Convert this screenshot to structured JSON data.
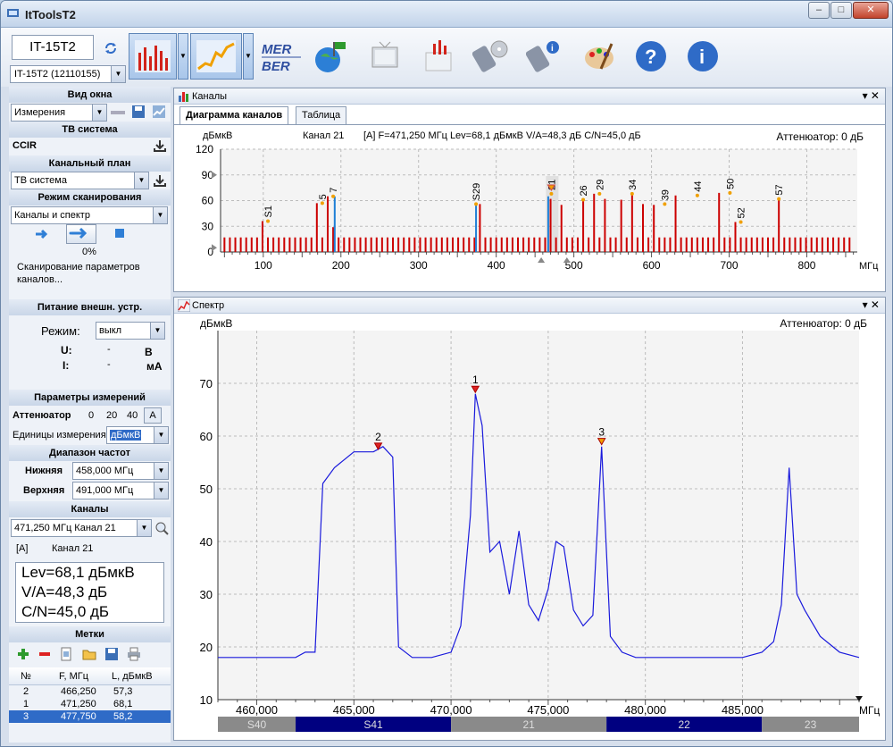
{
  "app": {
    "title": "ItToolsT2"
  },
  "device": {
    "name": "IT-15T2",
    "selector": "IT-15T2 (12110155)"
  },
  "sidebar": {
    "view_header": "Вид окна",
    "view_value": "Измерения",
    "tv_header": "ТВ система",
    "tv_value": "CCIR",
    "plan_header": "Канальный план",
    "plan_value": "ТВ система",
    "scan_header": "Режим сканирования",
    "scan_value": "Каналы и спектр",
    "scan_progress": "0%",
    "scan_progress_fraction": 0,
    "scan_status": "Сканирование параметров каналов...",
    "power_header": "Питание внешн. устр.",
    "power_mode_label": "Режим:",
    "power_mode_value": "выкл",
    "u_label": "U:",
    "u_value": "-",
    "u_unit": "В",
    "i_label": "I:",
    "i_value": "-",
    "i_unit": "мА",
    "meas_header": "Параметры измерений",
    "attenuator_label": "Аттенюатор",
    "att_opts": [
      "0",
      "20",
      "40",
      "A"
    ],
    "units_label": "Единицы измерения",
    "units_value": "дБмкВ",
    "range_header": "Диапазон частот",
    "low_label": "Нижняя",
    "low_value": "458,000 МГц",
    "high_label": "Верхняя",
    "high_value": "491,000 МГц",
    "channels_header": "Каналы",
    "channel_value": "471,250 МГц  Канал 21",
    "ch_mark": "[A]",
    "ch_name": "Канал 21",
    "lev": "Lev=68,1 дБмкВ",
    "va": "V/A=48,3 дБ",
    "cn": "C/N=45,0 дБ",
    "markers_header": "Метки",
    "markers_cols": [
      "№",
      "F, МГц",
      "L, дБмкВ"
    ],
    "markers": [
      {
        "n": "2",
        "f": "466,250",
        "l": "57,3"
      },
      {
        "n": "1",
        "f": "471,250",
        "l": "68,1"
      },
      {
        "n": "3",
        "f": "477,750",
        "l": "58,2"
      }
    ]
  },
  "channels_panel": {
    "title": "Каналы",
    "tabs": [
      "Диаграмма каналов",
      "Таблица"
    ],
    "info": "[A]   F=471,250 МГц  Lev=68,1 дБмкВ  V/A=48,3 дБ   C/N=45,0 дБ",
    "channel_title": "Канал 21",
    "attenuator": "Аттенюатор: 0 дБ"
  },
  "spectrum_panel": {
    "title": "Спектр",
    "attenuator": "Аттенюатор: 0 дБ"
  },
  "colors": {
    "accent": "#2f6bc7",
    "bar_red": "#cc0000",
    "bar_blue": "#1f7fd6",
    "trace": "#1a1adc"
  },
  "chart_data": [
    {
      "type": "bar",
      "ylabel": "дБмкВ",
      "xlabel": "МГц",
      "ylim": [
        0,
        120
      ],
      "xlim": [
        45,
        865
      ],
      "x_ticks": [
        100,
        200,
        300,
        400,
        500,
        600,
        700,
        800
      ],
      "y_ticks": [
        0,
        30,
        60,
        90,
        120
      ],
      "grid": true,
      "bars_x": [
        50,
        57,
        64,
        71,
        78,
        85,
        92,
        99,
        106,
        113,
        120,
        127,
        134,
        141,
        148,
        155,
        162,
        169,
        176,
        183,
        190,
        197,
        204,
        211,
        218,
        225,
        232,
        239,
        246,
        253,
        260,
        267,
        274,
        281,
        288,
        295,
        302,
        309,
        316,
        323,
        330,
        337,
        344,
        351,
        358,
        365,
        372,
        379,
        386,
        393,
        400,
        407,
        414,
        421,
        428,
        435,
        442,
        449,
        456,
        463,
        470,
        477,
        484,
        491,
        498,
        505,
        512,
        519,
        526,
        533,
        540,
        547,
        554,
        561,
        568,
        575,
        582,
        589,
        596,
        603,
        610,
        617,
        624,
        631,
        638,
        645,
        652,
        659,
        666,
        673,
        680,
        687,
        694,
        701,
        708,
        715,
        722,
        729,
        736,
        743,
        750,
        757,
        764,
        771,
        778,
        785,
        792,
        799,
        806,
        813,
        820,
        827,
        834,
        841,
        848,
        855
      ],
      "bars_y": [
        17,
        17,
        17,
        17,
        17,
        17,
        17,
        36,
        17,
        17,
        17,
        17,
        17,
        17,
        17,
        17,
        17,
        57,
        17,
        65,
        29,
        17,
        17,
        17,
        17,
        17,
        17,
        17,
        17,
        17,
        17,
        17,
        17,
        17,
        17,
        17,
        17,
        17,
        17,
        17,
        17,
        17,
        17,
        17,
        17,
        17,
        17,
        56,
        17,
        17,
        17,
        17,
        17,
        17,
        17,
        17,
        17,
        17,
        17,
        17,
        62,
        17,
        55,
        17,
        17,
        17,
        61,
        17,
        68,
        17,
        62,
        17,
        17,
        61,
        17,
        68,
        17,
        56,
        17,
        55,
        17,
        17,
        17,
        66,
        17,
        17,
        17,
        17,
        17,
        17,
        17,
        69,
        17,
        17,
        35,
        17,
        17,
        17,
        17,
        17,
        17,
        17,
        62,
        17,
        17,
        17,
        17,
        17,
        17,
        17,
        17,
        17,
        17,
        17,
        17,
        17
      ],
      "blue_bars_x": [
        192,
        374,
        467
      ],
      "blue_bars_y": [
        65,
        56,
        65
      ],
      "channel_labels": [
        {
          "label": "S1",
          "x": 106,
          "y": 36
        },
        {
          "label": "5",
          "x": 176,
          "y": 57
        },
        {
          "label": "7",
          "x": 190,
          "y": 65
        },
        {
          "label": "S29",
          "x": 374,
          "y": 56
        },
        {
          "label": "21",
          "x": 471,
          "y": 68
        },
        {
          "label": "26",
          "x": 512,
          "y": 61
        },
        {
          "label": "29",
          "x": 533,
          "y": 68
        },
        {
          "label": "34",
          "x": 575,
          "y": 68
        },
        {
          "label": "39",
          "x": 617,
          "y": 56
        },
        {
          "label": "44",
          "x": 659,
          "y": 66
        },
        {
          "label": "50",
          "x": 701,
          "y": 69
        },
        {
          "label": "52",
          "x": 715,
          "y": 35
        },
        {
          "label": "57",
          "x": 764,
          "y": 62
        }
      ],
      "selected_channel_x": 471
    },
    {
      "type": "line",
      "ylabel": "дБмкВ",
      "xlabel": "МГц",
      "ylim": [
        10,
        80
      ],
      "xlim": [
        458,
        491
      ],
      "x_ticks": [
        460,
        465,
        470,
        475,
        480,
        485
      ],
      "x_tick_labels": [
        "460,000",
        "465,000",
        "470,000",
        "475,000",
        "480,000",
        "485,000"
      ],
      "y_ticks": [
        10,
        20,
        30,
        40,
        50,
        60,
        70
      ],
      "grid": true,
      "series": [
        {
          "x": [
            458.0,
            459.0,
            460.0,
            461.0,
            462.0,
            462.5,
            463.0,
            463.4,
            464.0,
            465.0,
            466.0,
            466.5,
            467.0,
            467.3,
            468.0,
            469.0,
            470.0,
            470.5,
            471.0,
            471.25,
            471.6,
            472.0,
            472.5,
            473.0,
            473.5,
            474.0,
            474.5,
            475.0,
            475.4,
            475.8,
            476.3,
            476.8,
            477.3,
            477.75,
            478.2,
            478.8,
            479.5,
            481.0,
            483.0,
            485.0,
            486.0,
            486.6,
            487.0,
            487.4,
            487.8,
            488.2,
            489.0,
            490.0,
            491.0
          ],
          "y": [
            18,
            18,
            18,
            18,
            18,
            19,
            19,
            51,
            54,
            57,
            57,
            58,
            56,
            20,
            18,
            18,
            19,
            24,
            45,
            68,
            62,
            38,
            40,
            30,
            42,
            28,
            25,
            31,
            40,
            39,
            27,
            24,
            26,
            58,
            22,
            19,
            18,
            18,
            18,
            18,
            19,
            21,
            28,
            54,
            30,
            27,
            22,
            19,
            18
          ]
        }
      ],
      "markers": [
        {
          "label": "1",
          "x": 471.25,
          "y": 68.1
        },
        {
          "label": "2",
          "x": 466.25,
          "y": 57.3
        },
        {
          "label": "3",
          "x": 477.75,
          "y": 58.2
        }
      ],
      "channel_strip": [
        {
          "name": "S40",
          "from": 458,
          "to": 462
        },
        {
          "name": "S41",
          "from": 462,
          "to": 470
        },
        {
          "name": "21",
          "from": 470,
          "to": 478
        },
        {
          "name": "22",
          "from": 478,
          "to": 486
        },
        {
          "name": "23",
          "from": 486,
          "to": 491
        }
      ]
    }
  ]
}
